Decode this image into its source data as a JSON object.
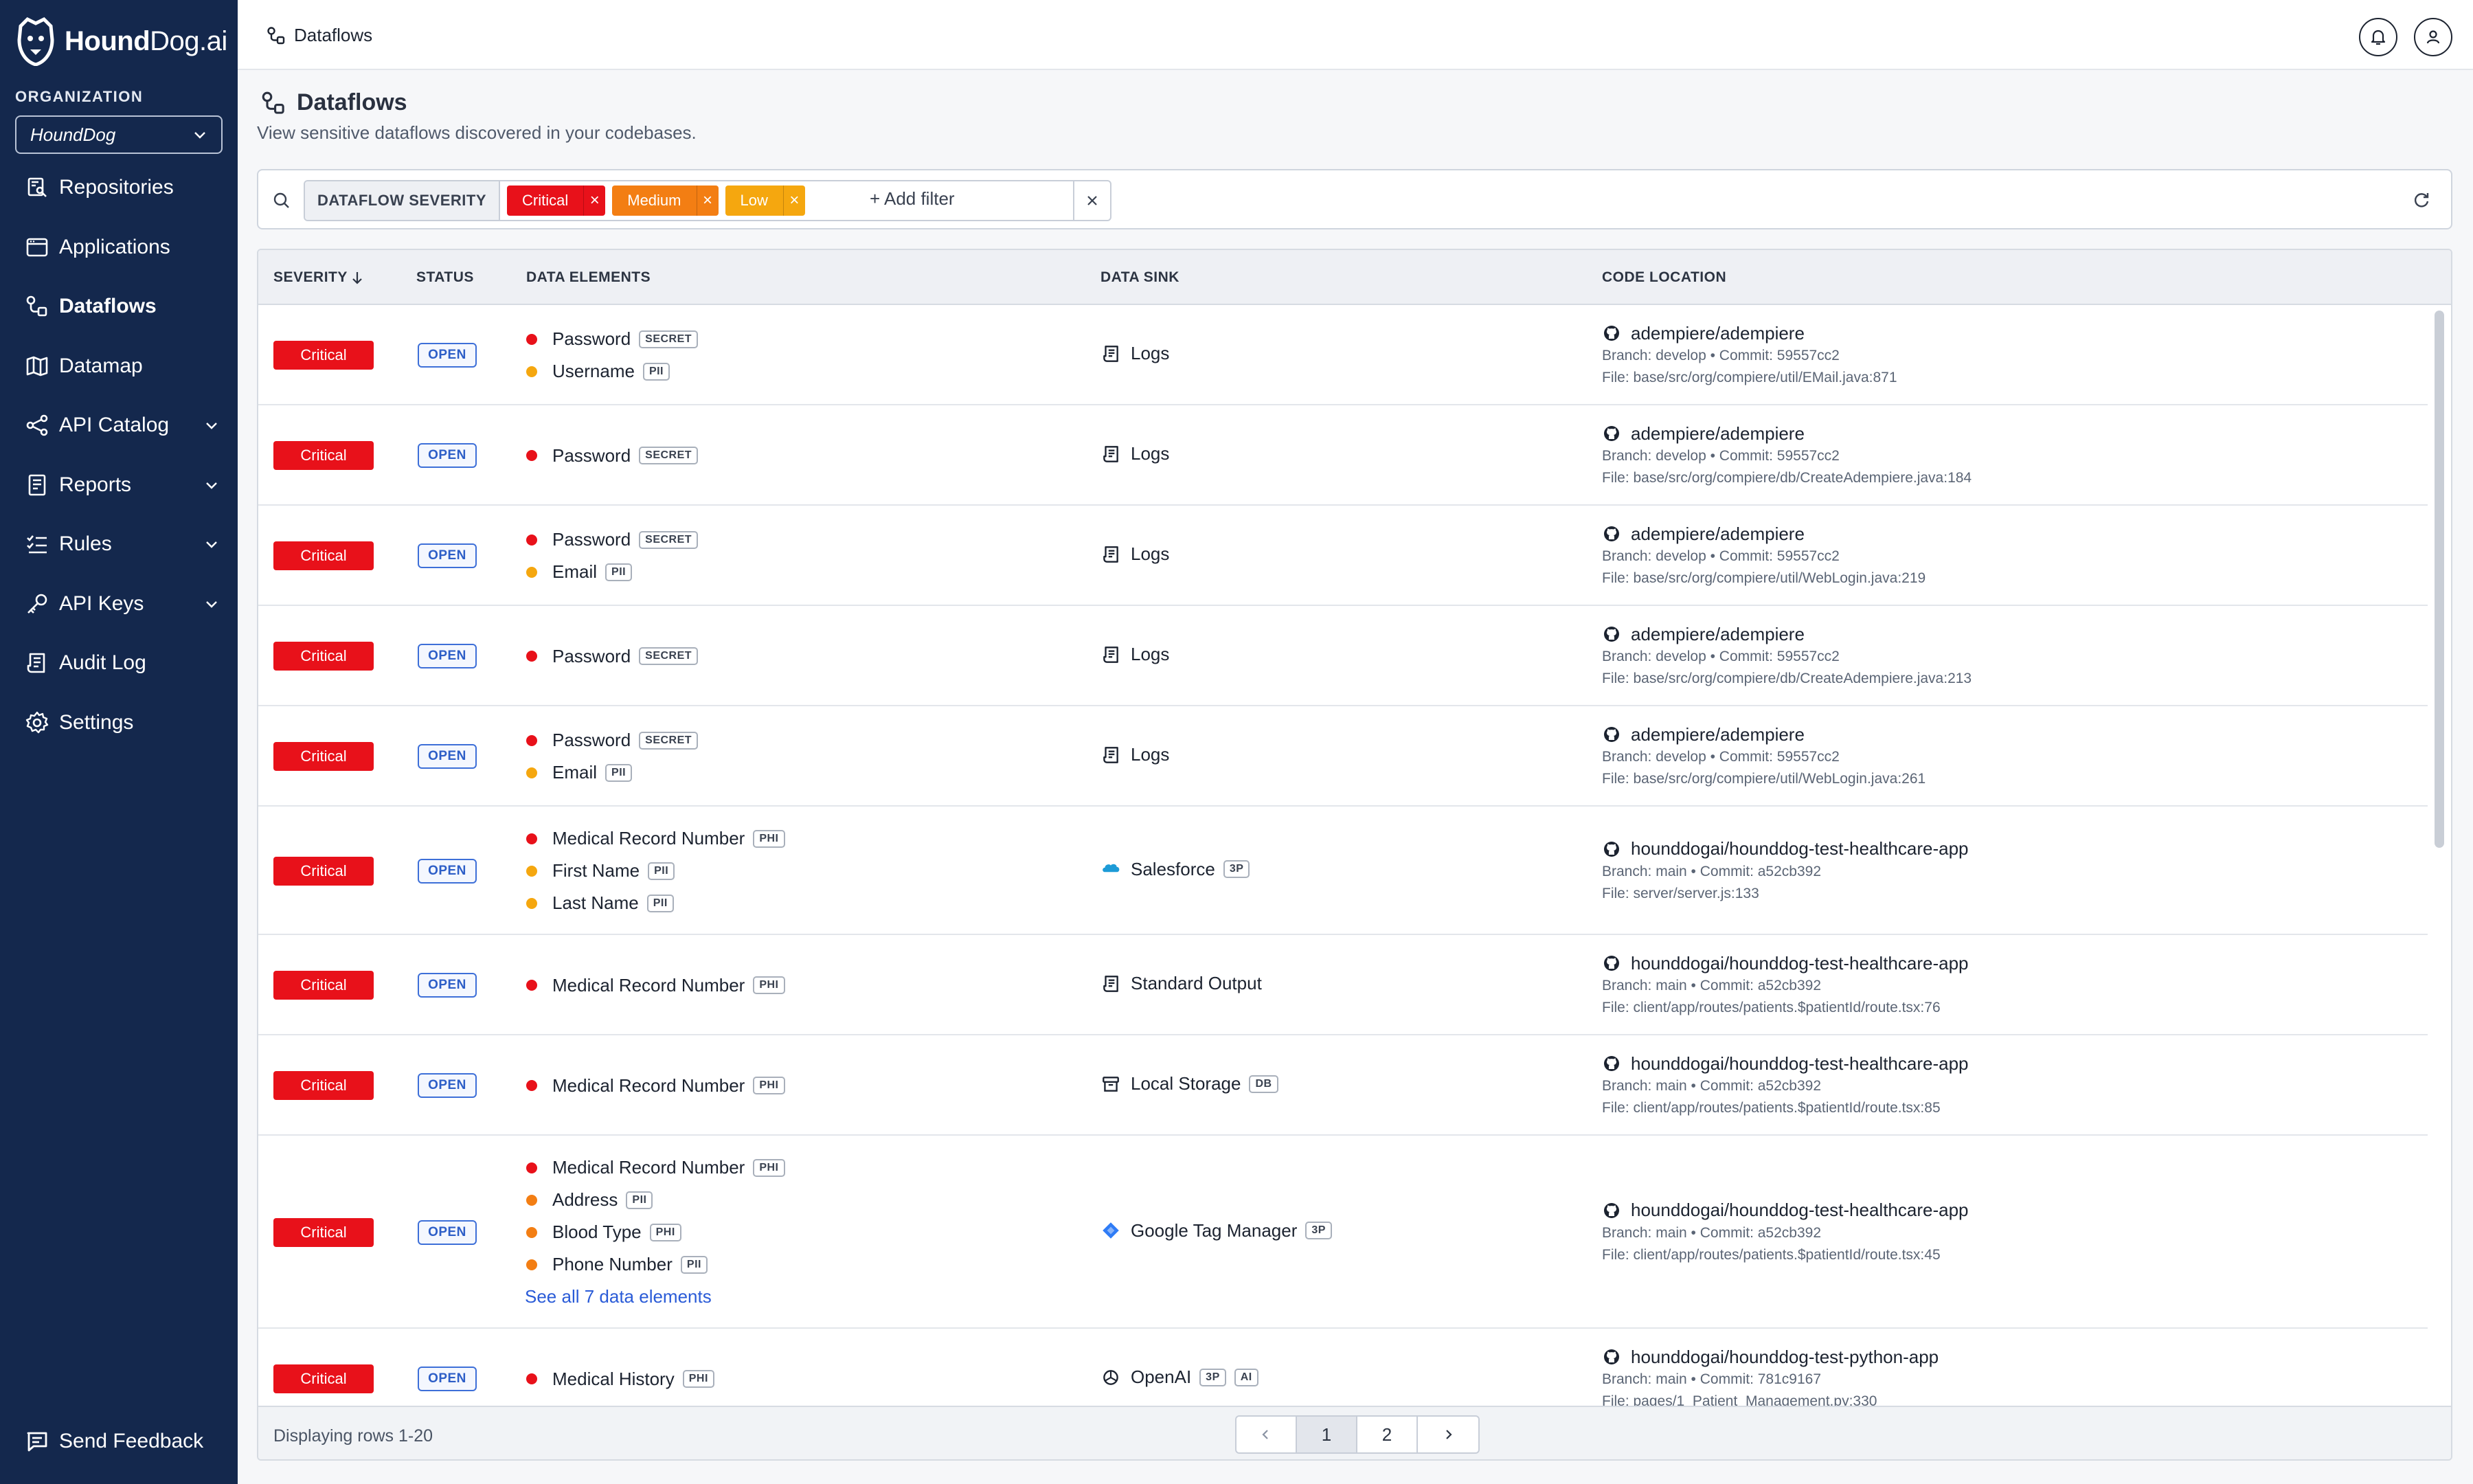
{
  "brand": {
    "name_bold": "Hound",
    "name_rest": "Dog.ai"
  },
  "org": {
    "label": "ORGANIZATION",
    "selected": "HoundDog"
  },
  "nav": [
    {
      "label": "Repositories",
      "icon": "repositories-icon"
    },
    {
      "label": "Applications",
      "icon": "applications-icon"
    },
    {
      "label": "Dataflows",
      "icon": "dataflows-icon",
      "active": true
    },
    {
      "label": "Datamap",
      "icon": "datamap-icon"
    },
    {
      "label": "API Catalog",
      "icon": "api-catalog-icon",
      "expandable": true
    },
    {
      "label": "Reports",
      "icon": "reports-icon",
      "expandable": true
    },
    {
      "label": "Rules",
      "icon": "rules-icon",
      "expandable": true
    },
    {
      "label": "API Keys",
      "icon": "key-icon",
      "expandable": true
    },
    {
      "label": "Audit Log",
      "icon": "audit-log-icon"
    },
    {
      "label": "Settings",
      "icon": "gear-icon"
    }
  ],
  "feedback": {
    "label": "Send Feedback"
  },
  "topbar": {
    "breadcrumb": "Dataflows"
  },
  "page": {
    "title": "Dataflows",
    "subtitle": "View sensitive dataflows discovered in your codebases."
  },
  "filter": {
    "field": "DATAFLOW SEVERITY",
    "values": [
      {
        "label": "Critical",
        "color": "#e8111a"
      },
      {
        "label": "Medium",
        "color": "#f37e13"
      },
      {
        "label": "Low",
        "color": "#f5a70f"
      }
    ],
    "add_label": "+ Add filter"
  },
  "table": {
    "columns": {
      "severity": "SEVERITY",
      "status": "STATUS",
      "elements": "DATA ELEMENTS",
      "sink": "DATA SINK",
      "code": "CODE LOCATION"
    },
    "rows": [
      {
        "severity": "Critical",
        "status": "OPEN",
        "elements": [
          {
            "name": "Password",
            "tag": "SECRET",
            "color": "#e8111a"
          },
          {
            "name": "Username",
            "tag": "PII",
            "color": "#f5a70f"
          }
        ],
        "sink": {
          "name": "Logs",
          "icon": "logs-icon",
          "tags": []
        },
        "repo": "adempiere/adempiere",
        "meta": "Branch: develop • Commit: 59557cc2",
        "file": "File: base/src/org/compiere/util/EMail.java:871"
      },
      {
        "severity": "Critical",
        "status": "OPEN",
        "elements": [
          {
            "name": "Password",
            "tag": "SECRET",
            "color": "#e8111a"
          }
        ],
        "sink": {
          "name": "Logs",
          "icon": "logs-icon",
          "tags": []
        },
        "repo": "adempiere/adempiere",
        "meta": "Branch: develop • Commit: 59557cc2",
        "file": "File: base/src/org/compiere/db/CreateAdempiere.java:184"
      },
      {
        "severity": "Critical",
        "status": "OPEN",
        "elements": [
          {
            "name": "Password",
            "tag": "SECRET",
            "color": "#e8111a"
          },
          {
            "name": "Email",
            "tag": "PII",
            "color": "#f5a70f"
          }
        ],
        "sink": {
          "name": "Logs",
          "icon": "logs-icon",
          "tags": []
        },
        "repo": "adempiere/adempiere",
        "meta": "Branch: develop • Commit: 59557cc2",
        "file": "File: base/src/org/compiere/util/WebLogin.java:219"
      },
      {
        "severity": "Critical",
        "status": "OPEN",
        "elements": [
          {
            "name": "Password",
            "tag": "SECRET",
            "color": "#e8111a"
          }
        ],
        "sink": {
          "name": "Logs",
          "icon": "logs-icon",
          "tags": []
        },
        "repo": "adempiere/adempiere",
        "meta": "Branch: develop • Commit: 59557cc2",
        "file": "File: base/src/org/compiere/db/CreateAdempiere.java:213"
      },
      {
        "severity": "Critical",
        "status": "OPEN",
        "elements": [
          {
            "name": "Password",
            "tag": "SECRET",
            "color": "#e8111a"
          },
          {
            "name": "Email",
            "tag": "PII",
            "color": "#f5a70f"
          }
        ],
        "sink": {
          "name": "Logs",
          "icon": "logs-icon",
          "tags": []
        },
        "repo": "adempiere/adempiere",
        "meta": "Branch: develop • Commit: 59557cc2",
        "file": "File: base/src/org/compiere/util/WebLogin.java:261"
      },
      {
        "severity": "Critical",
        "status": "OPEN",
        "elements": [
          {
            "name": "Medical Record Number",
            "tag": "PHI",
            "color": "#e8111a"
          },
          {
            "name": "First Name",
            "tag": "PII",
            "color": "#f5a70f"
          },
          {
            "name": "Last Name",
            "tag": "PII",
            "color": "#f5a70f"
          }
        ],
        "sink": {
          "name": "Salesforce",
          "icon": "salesforce-icon",
          "tags": [
            "3P"
          ]
        },
        "repo": "hounddogai/hounddog-test-healthcare-app",
        "meta": "Branch: main • Commit: a52cb392",
        "file": "File: server/server.js:133"
      },
      {
        "severity": "Critical",
        "status": "OPEN",
        "elements": [
          {
            "name": "Medical Record Number",
            "tag": "PHI",
            "color": "#e8111a"
          }
        ],
        "sink": {
          "name": "Standard Output",
          "icon": "logs-icon",
          "tags": []
        },
        "repo": "hounddogai/hounddog-test-healthcare-app",
        "meta": "Branch: main • Commit: a52cb392",
        "file": "File: client/app/routes/patients.$patientId/route.tsx:76"
      },
      {
        "severity": "Critical",
        "status": "OPEN",
        "elements": [
          {
            "name": "Medical Record Number",
            "tag": "PHI",
            "color": "#e8111a"
          }
        ],
        "sink": {
          "name": "Local Storage",
          "icon": "archive-icon",
          "tags": [
            "DB"
          ]
        },
        "repo": "hounddogai/hounddog-test-healthcare-app",
        "meta": "Branch: main • Commit: a52cb392",
        "file": "File: client/app/routes/patients.$patientId/route.tsx:85"
      },
      {
        "severity": "Critical",
        "status": "OPEN",
        "elements": [
          {
            "name": "Medical Record Number",
            "tag": "PHI",
            "color": "#e8111a"
          },
          {
            "name": "Address",
            "tag": "PII",
            "color": "#f37e13"
          },
          {
            "name": "Blood Type",
            "tag": "PHI",
            "color": "#f37e13"
          },
          {
            "name": "Phone Number",
            "tag": "PII",
            "color": "#f37e13"
          }
        ],
        "see_all": "See all 7 data elements",
        "sink": {
          "name": "Google Tag Manager",
          "icon": "google-tag-manager-icon",
          "tags": [
            "3P"
          ]
        },
        "repo": "hounddogai/hounddog-test-healthcare-app",
        "meta": "Branch: main • Commit: a52cb392",
        "file": "File: client/app/routes/patients.$patientId/route.tsx:45"
      },
      {
        "severity": "Critical",
        "status": "OPEN",
        "elements": [
          {
            "name": "Medical History",
            "tag": "PHI",
            "color": "#e8111a"
          }
        ],
        "sink": {
          "name": "OpenAI",
          "icon": "openai-icon",
          "tags": [
            "3P",
            "AI"
          ]
        },
        "repo": "hounddogai/hounddog-test-python-app",
        "meta": "Branch: main • Commit: 781c9167",
        "file": "File: pages/1_Patient_Management.py:330"
      }
    ]
  },
  "footer": {
    "rows_info": "Displaying rows 1-20",
    "pages": [
      "1",
      "2"
    ],
    "current_page": "1"
  }
}
